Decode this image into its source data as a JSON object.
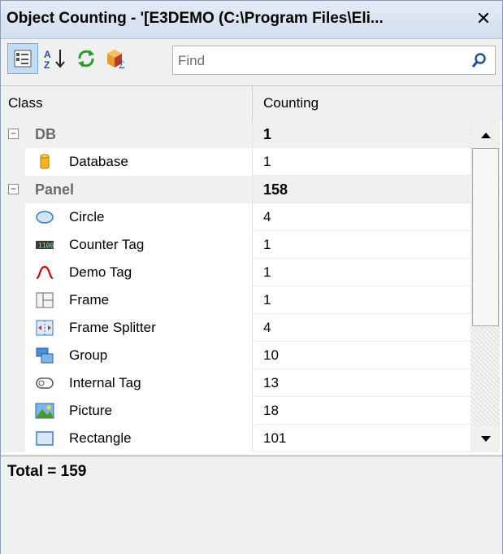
{
  "window": {
    "title": "Object Counting - '[E3DEMO (C:\\Program Files\\Eli..."
  },
  "toolbar": {
    "buttons": [
      {
        "name": "categorized-view",
        "icon": "categorized-icon",
        "active": true
      },
      {
        "name": "sort-alphabetical",
        "icon": "sort-az-icon",
        "active": false
      },
      {
        "name": "refresh",
        "icon": "refresh-icon",
        "active": false
      },
      {
        "name": "statistics",
        "icon": "stats-icon",
        "active": false
      }
    ]
  },
  "search": {
    "placeholder": "Find",
    "value": ""
  },
  "columns": {
    "class": "Class",
    "counting": "Counting"
  },
  "groups": [
    {
      "label": "DB",
      "count": "1",
      "expander": "−",
      "items": [
        {
          "label": "Database",
          "count": "1",
          "icon": "database-icon"
        }
      ]
    },
    {
      "label": "Panel",
      "count": "158",
      "expander": "−",
      "items": [
        {
          "label": "Circle",
          "count": "4",
          "icon": "circle-icon"
        },
        {
          "label": "Counter Tag",
          "count": "1",
          "icon": "counter-tag-icon"
        },
        {
          "label": "Demo Tag",
          "count": "1",
          "icon": "demo-tag-icon"
        },
        {
          "label": "Frame",
          "count": "1",
          "icon": "frame-icon"
        },
        {
          "label": "Frame Splitter",
          "count": "4",
          "icon": "frame-splitter-icon"
        },
        {
          "label": "Group",
          "count": "10",
          "icon": "group-icon"
        },
        {
          "label": "Internal Tag",
          "count": "13",
          "icon": "internal-tag-icon"
        },
        {
          "label": "Picture",
          "count": "18",
          "icon": "picture-icon"
        },
        {
          "label": "Rectangle",
          "count": "101",
          "icon": "rectangle-icon"
        }
      ]
    }
  ],
  "footer": {
    "total": "Total = 159"
  },
  "colors": {
    "title_bar": "#d3deee",
    "active_button": "#c4dcf3",
    "accent_green": "#2e9b2e",
    "demo_tag_red": "#e00000"
  }
}
